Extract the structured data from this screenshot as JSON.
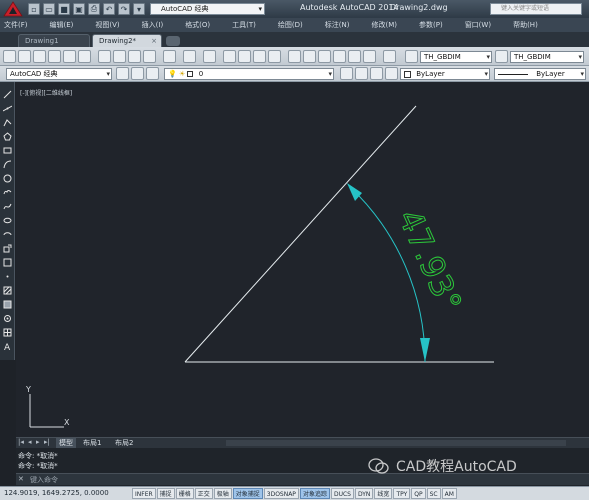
{
  "titlebar": {
    "workspace": "AutoCAD 经典",
    "app_title": "Autodesk AutoCAD 2014",
    "file_title": "Drawing2.dwg",
    "search_placeholder": "键入关键字或短语"
  },
  "menu": {
    "items": [
      "文件(F)",
      "编辑(E)",
      "视图(V)",
      "插入(I)",
      "格式(O)",
      "工具(T)",
      "绘图(D)",
      "标注(N)",
      "修改(M)",
      "参数(P)",
      "窗口(W)",
      "帮助(H)"
    ]
  },
  "tabs": {
    "items": [
      "Drawing1",
      "Drawing2*"
    ]
  },
  "toolbar": {
    "text_style": "TH_GBDIM",
    "dim_style": "TH_GBDIM",
    "workspace": "AutoCAD 经典",
    "layer": "0",
    "color": "ByLayer",
    "linetype": "ByLayer"
  },
  "canvas": {
    "viewport_label": "[-][俯视][二维线框]",
    "dimension_text": "47.93°",
    "ucs_y": "Y",
    "ucs_x": "X"
  },
  "layout": {
    "tabs": [
      "模型",
      "布局1",
      "布局2"
    ]
  },
  "command": {
    "history": [
      "命令: *取消*",
      "命令: *取消*"
    ],
    "prompt": "键入命令"
  },
  "watermark": "CAD教程AutoCAD",
  "status": {
    "coords": "124.9019, 1649.2725, 0.0000",
    "toggles": [
      {
        "label": "INFER",
        "on": false
      },
      {
        "label": "捕捉",
        "on": false
      },
      {
        "label": "栅格",
        "on": false
      },
      {
        "label": "正交",
        "on": false
      },
      {
        "label": "极轴",
        "on": false
      },
      {
        "label": "对象捕捉",
        "on": true
      },
      {
        "label": "3DOSNAP",
        "on": false
      },
      {
        "label": "对象追踪",
        "on": true
      },
      {
        "label": "DUCS",
        "on": false
      },
      {
        "label": "DYN",
        "on": false
      },
      {
        "label": "线宽",
        "on": false
      },
      {
        "label": "TPY",
        "on": false
      },
      {
        "label": "QP",
        "on": false
      },
      {
        "label": "SC",
        "on": false
      },
      {
        "label": "AM",
        "on": false
      }
    ]
  },
  "colors": {
    "canvas_bg": "#20242b",
    "line": "#e6ecef",
    "dimension": "#26c3c7",
    "dim_text": "#2cc83a",
    "status_on": "#9fc4ea"
  }
}
